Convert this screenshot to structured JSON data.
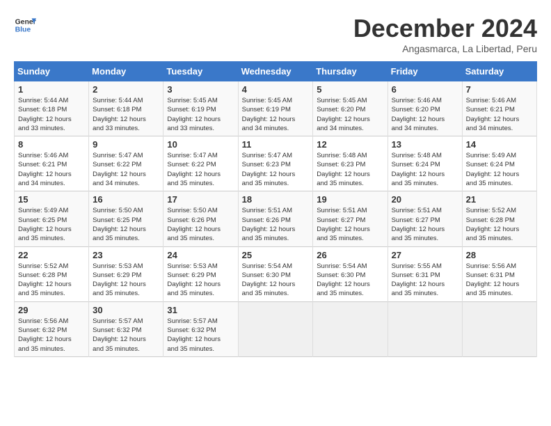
{
  "header": {
    "logo_line1": "General",
    "logo_line2": "Blue",
    "month": "December 2024",
    "location": "Angasmarca, La Libertad, Peru"
  },
  "days_of_week": [
    "Sunday",
    "Monday",
    "Tuesday",
    "Wednesday",
    "Thursday",
    "Friday",
    "Saturday"
  ],
  "weeks": [
    [
      {
        "num": "1",
        "rise": "5:44 AM",
        "set": "6:18 PM",
        "daylight": "12 hours and 33 minutes."
      },
      {
        "num": "2",
        "rise": "5:44 AM",
        "set": "6:18 PM",
        "daylight": "12 hours and 33 minutes."
      },
      {
        "num": "3",
        "rise": "5:45 AM",
        "set": "6:19 PM",
        "daylight": "12 hours and 33 minutes."
      },
      {
        "num": "4",
        "rise": "5:45 AM",
        "set": "6:19 PM",
        "daylight": "12 hours and 34 minutes."
      },
      {
        "num": "5",
        "rise": "5:45 AM",
        "set": "6:20 PM",
        "daylight": "12 hours and 34 minutes."
      },
      {
        "num": "6",
        "rise": "5:46 AM",
        "set": "6:20 PM",
        "daylight": "12 hours and 34 minutes."
      },
      {
        "num": "7",
        "rise": "5:46 AM",
        "set": "6:21 PM",
        "daylight": "12 hours and 34 minutes."
      }
    ],
    [
      {
        "num": "8",
        "rise": "5:46 AM",
        "set": "6:21 PM",
        "daylight": "12 hours and 34 minutes."
      },
      {
        "num": "9",
        "rise": "5:47 AM",
        "set": "6:22 PM",
        "daylight": "12 hours and 34 minutes."
      },
      {
        "num": "10",
        "rise": "5:47 AM",
        "set": "6:22 PM",
        "daylight": "12 hours and 35 minutes."
      },
      {
        "num": "11",
        "rise": "5:47 AM",
        "set": "6:23 PM",
        "daylight": "12 hours and 35 minutes."
      },
      {
        "num": "12",
        "rise": "5:48 AM",
        "set": "6:23 PM",
        "daylight": "12 hours and 35 minutes."
      },
      {
        "num": "13",
        "rise": "5:48 AM",
        "set": "6:24 PM",
        "daylight": "12 hours and 35 minutes."
      },
      {
        "num": "14",
        "rise": "5:49 AM",
        "set": "6:24 PM",
        "daylight": "12 hours and 35 minutes."
      }
    ],
    [
      {
        "num": "15",
        "rise": "5:49 AM",
        "set": "6:25 PM",
        "daylight": "12 hours and 35 minutes."
      },
      {
        "num": "16",
        "rise": "5:50 AM",
        "set": "6:25 PM",
        "daylight": "12 hours and 35 minutes."
      },
      {
        "num": "17",
        "rise": "5:50 AM",
        "set": "6:26 PM",
        "daylight": "12 hours and 35 minutes."
      },
      {
        "num": "18",
        "rise": "5:51 AM",
        "set": "6:26 PM",
        "daylight": "12 hours and 35 minutes."
      },
      {
        "num": "19",
        "rise": "5:51 AM",
        "set": "6:27 PM",
        "daylight": "12 hours and 35 minutes."
      },
      {
        "num": "20",
        "rise": "5:51 AM",
        "set": "6:27 PM",
        "daylight": "12 hours and 35 minutes."
      },
      {
        "num": "21",
        "rise": "5:52 AM",
        "set": "6:28 PM",
        "daylight": "12 hours and 35 minutes."
      }
    ],
    [
      {
        "num": "22",
        "rise": "5:52 AM",
        "set": "6:28 PM",
        "daylight": "12 hours and 35 minutes."
      },
      {
        "num": "23",
        "rise": "5:53 AM",
        "set": "6:29 PM",
        "daylight": "12 hours and 35 minutes."
      },
      {
        "num": "24",
        "rise": "5:53 AM",
        "set": "6:29 PM",
        "daylight": "12 hours and 35 minutes."
      },
      {
        "num": "25",
        "rise": "5:54 AM",
        "set": "6:30 PM",
        "daylight": "12 hours and 35 minutes."
      },
      {
        "num": "26",
        "rise": "5:54 AM",
        "set": "6:30 PM",
        "daylight": "12 hours and 35 minutes."
      },
      {
        "num": "27",
        "rise": "5:55 AM",
        "set": "6:31 PM",
        "daylight": "12 hours and 35 minutes."
      },
      {
        "num": "28",
        "rise": "5:56 AM",
        "set": "6:31 PM",
        "daylight": "12 hours and 35 minutes."
      }
    ],
    [
      {
        "num": "29",
        "rise": "5:56 AM",
        "set": "6:32 PM",
        "daylight": "12 hours and 35 minutes."
      },
      {
        "num": "30",
        "rise": "5:57 AM",
        "set": "6:32 PM",
        "daylight": "12 hours and 35 minutes."
      },
      {
        "num": "31",
        "rise": "5:57 AM",
        "set": "6:32 PM",
        "daylight": "12 hours and 35 minutes."
      },
      null,
      null,
      null,
      null
    ]
  ]
}
